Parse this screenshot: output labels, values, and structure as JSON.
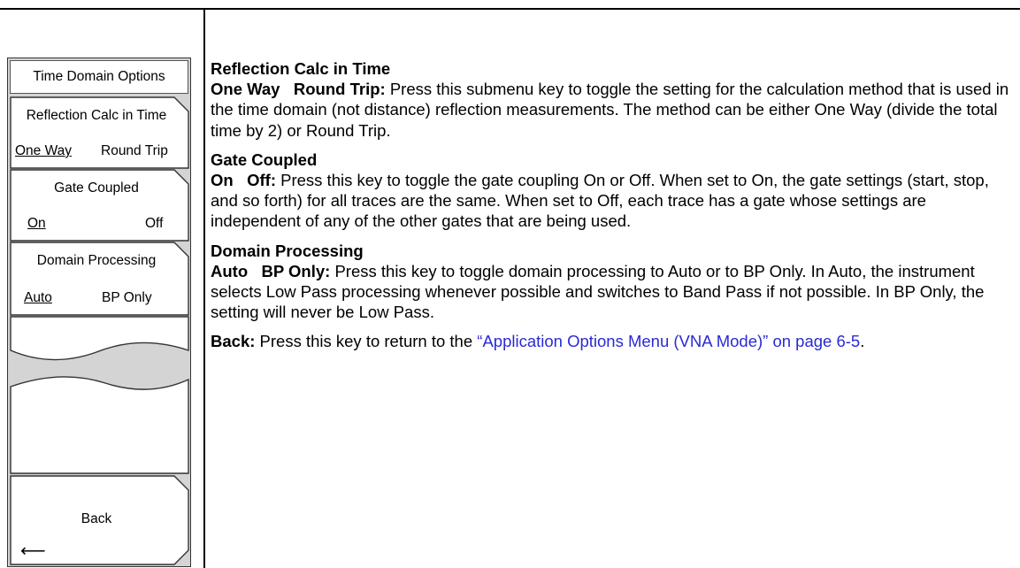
{
  "menu": {
    "title": "Time Domain Options",
    "reflection": {
      "label": "Reflection Calc in Time",
      "opt1": "One Way",
      "opt2": "Round Trip",
      "selected": "opt1"
    },
    "gate": {
      "label": "Gate Coupled",
      "opt1": "On",
      "opt2": "Off",
      "selected": "opt1"
    },
    "domain": {
      "label": "Domain Processing",
      "opt1": "Auto",
      "opt2": "BP Only",
      "selected": "opt1"
    },
    "back": {
      "label": "Back",
      "arrow": "⟵"
    }
  },
  "content": {
    "s1": {
      "heading": "Reflection Calc in Time",
      "lead": "One Way   Round Trip:",
      "body": " Press this submenu key to toggle the setting for the calculation method that is used in the time domain (not distance) reflection measurements. The method can be either One Way (divide the total time by 2) or Round Trip."
    },
    "s2": {
      "heading": "Gate Coupled",
      "lead": "On   Off:",
      "body": " Press this key to toggle the gate coupling On or Off. When set to On, the gate settings (start, stop, and so forth) for all traces are the same. When set to Off, each trace has a gate whose settings are independent of any of the other gates that are being used."
    },
    "s3": {
      "heading": "Domain Processing",
      "lead": "Auto   BP Only:",
      "body": " Press this key to toggle domain processing to Auto or to BP Only. In Auto, the instrument selects Low Pass processing whenever possible and switches to Band Pass if not possible. In BP Only, the setting will never be Low Pass."
    },
    "s4": {
      "lead": "Back:",
      "body": " Press this key to return to the ",
      "link": "“Application Options Menu (VNA Mode)” on page 6-5",
      "tail": "."
    }
  }
}
